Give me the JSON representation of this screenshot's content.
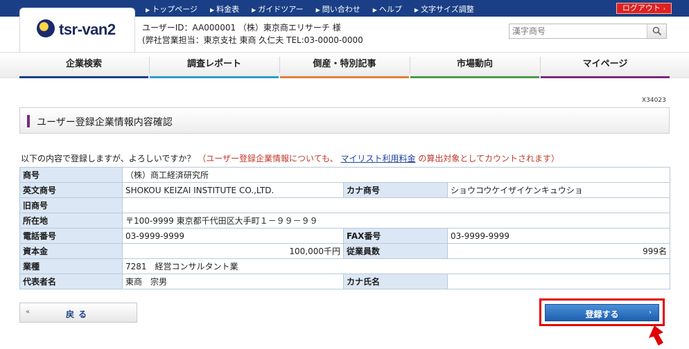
{
  "topnav": {
    "links": [
      "トップページ",
      "料金表",
      "ガイドツアー",
      "問い合わせ",
      "ヘルプ",
      "文字サイズ調整"
    ],
    "logout_label": "ログアウト"
  },
  "header": {
    "logo_text": "tsr-van2",
    "user_line": "ユーザーID：AA000001 （株）東京商エリサーチ 様",
    "contact_line": "(弊社営業担当：東京支社 東商 久仁夫 TEL:03-0000-0000",
    "search_placeholder": "漢字商号"
  },
  "gnav": {
    "items": [
      {
        "label": "企業検索",
        "color": "#1a3f86"
      },
      {
        "label": "調査レポート",
        "color": "#2aa0c8"
      },
      {
        "label": "倒産・特別記事",
        "color": "#e0803a"
      },
      {
        "label": "市場動向",
        "color": "#4a9a4a"
      },
      {
        "label": "マイページ",
        "color": "#7a2a7a"
      }
    ]
  },
  "screen_id": "X34023",
  "page_title": "ユーザー登録企業情報内容確認",
  "notice": {
    "text": "以下の内容で登録しますが、よろしいですか？",
    "red_prefix": "（ユーザー登録企業情報についても、",
    "link": "マイリスト利用料金",
    "red_suffix": "の算出対象としてカウントされます）"
  },
  "fields": {
    "name_label": "商号",
    "name_value": "（株）商工経済研究所",
    "en_label": "英文商号",
    "en_value": "SHOKOU KEIZAI INSTITUTE CO.,LTD.",
    "kana_label": "カナ商号",
    "kana_value": "ショウコウケイザイケンキュウショ",
    "old_label": "旧商号",
    "old_value": "",
    "addr_label": "所在地",
    "addr_value": "〒100-9999 東京都千代田区大手町１－９９－９９",
    "tel_label": "電話番号",
    "tel_value": "03-9999-9999",
    "fax_label": "FAX番号",
    "fax_value": "03-9999-9999",
    "capital_label": "資本金",
    "capital_value": "100,000千円",
    "emp_label": "従業員数",
    "emp_value": "999名",
    "industry_label": "業種",
    "industry_value": "7281　経営コンサルタント業",
    "rep_label": "代表者名",
    "rep_value": "東商　宗男",
    "rep_kana_label": "カナ氏名",
    "rep_kana_value": ""
  },
  "buttons": {
    "back_label": "戻る",
    "register_label": "登録する"
  }
}
